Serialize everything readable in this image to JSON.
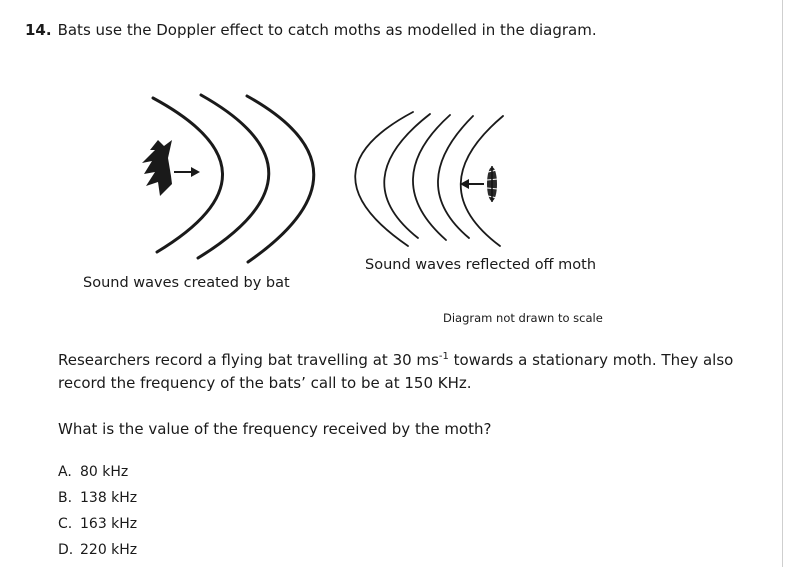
{
  "question": {
    "number": "14.",
    "text": "Bats use the Doppler effect to catch moths as modelled in the diagram."
  },
  "diagram": {
    "label_created": "Sound waves created by bat",
    "label_reflected": "Sound waves reflected off moth",
    "note": "Diagram not drawn to scale"
  },
  "body": {
    "line1_a": "Researchers record a flying bat travelling at 30 ms",
    "line1_sup": "-1",
    "line1_b": " towards a stationary moth. They also",
    "line2": "record the frequency of the bats’ call to be at 150 KHz.",
    "prompt": "What is the value of the frequency received by the moth?"
  },
  "options": [
    {
      "letter": "A.",
      "text": "80 kHz"
    },
    {
      "letter": "B.",
      "text": "138 kHz"
    },
    {
      "letter": "C.",
      "text": "163 kHz"
    },
    {
      "letter": "D.",
      "text": "220 kHz"
    }
  ]
}
